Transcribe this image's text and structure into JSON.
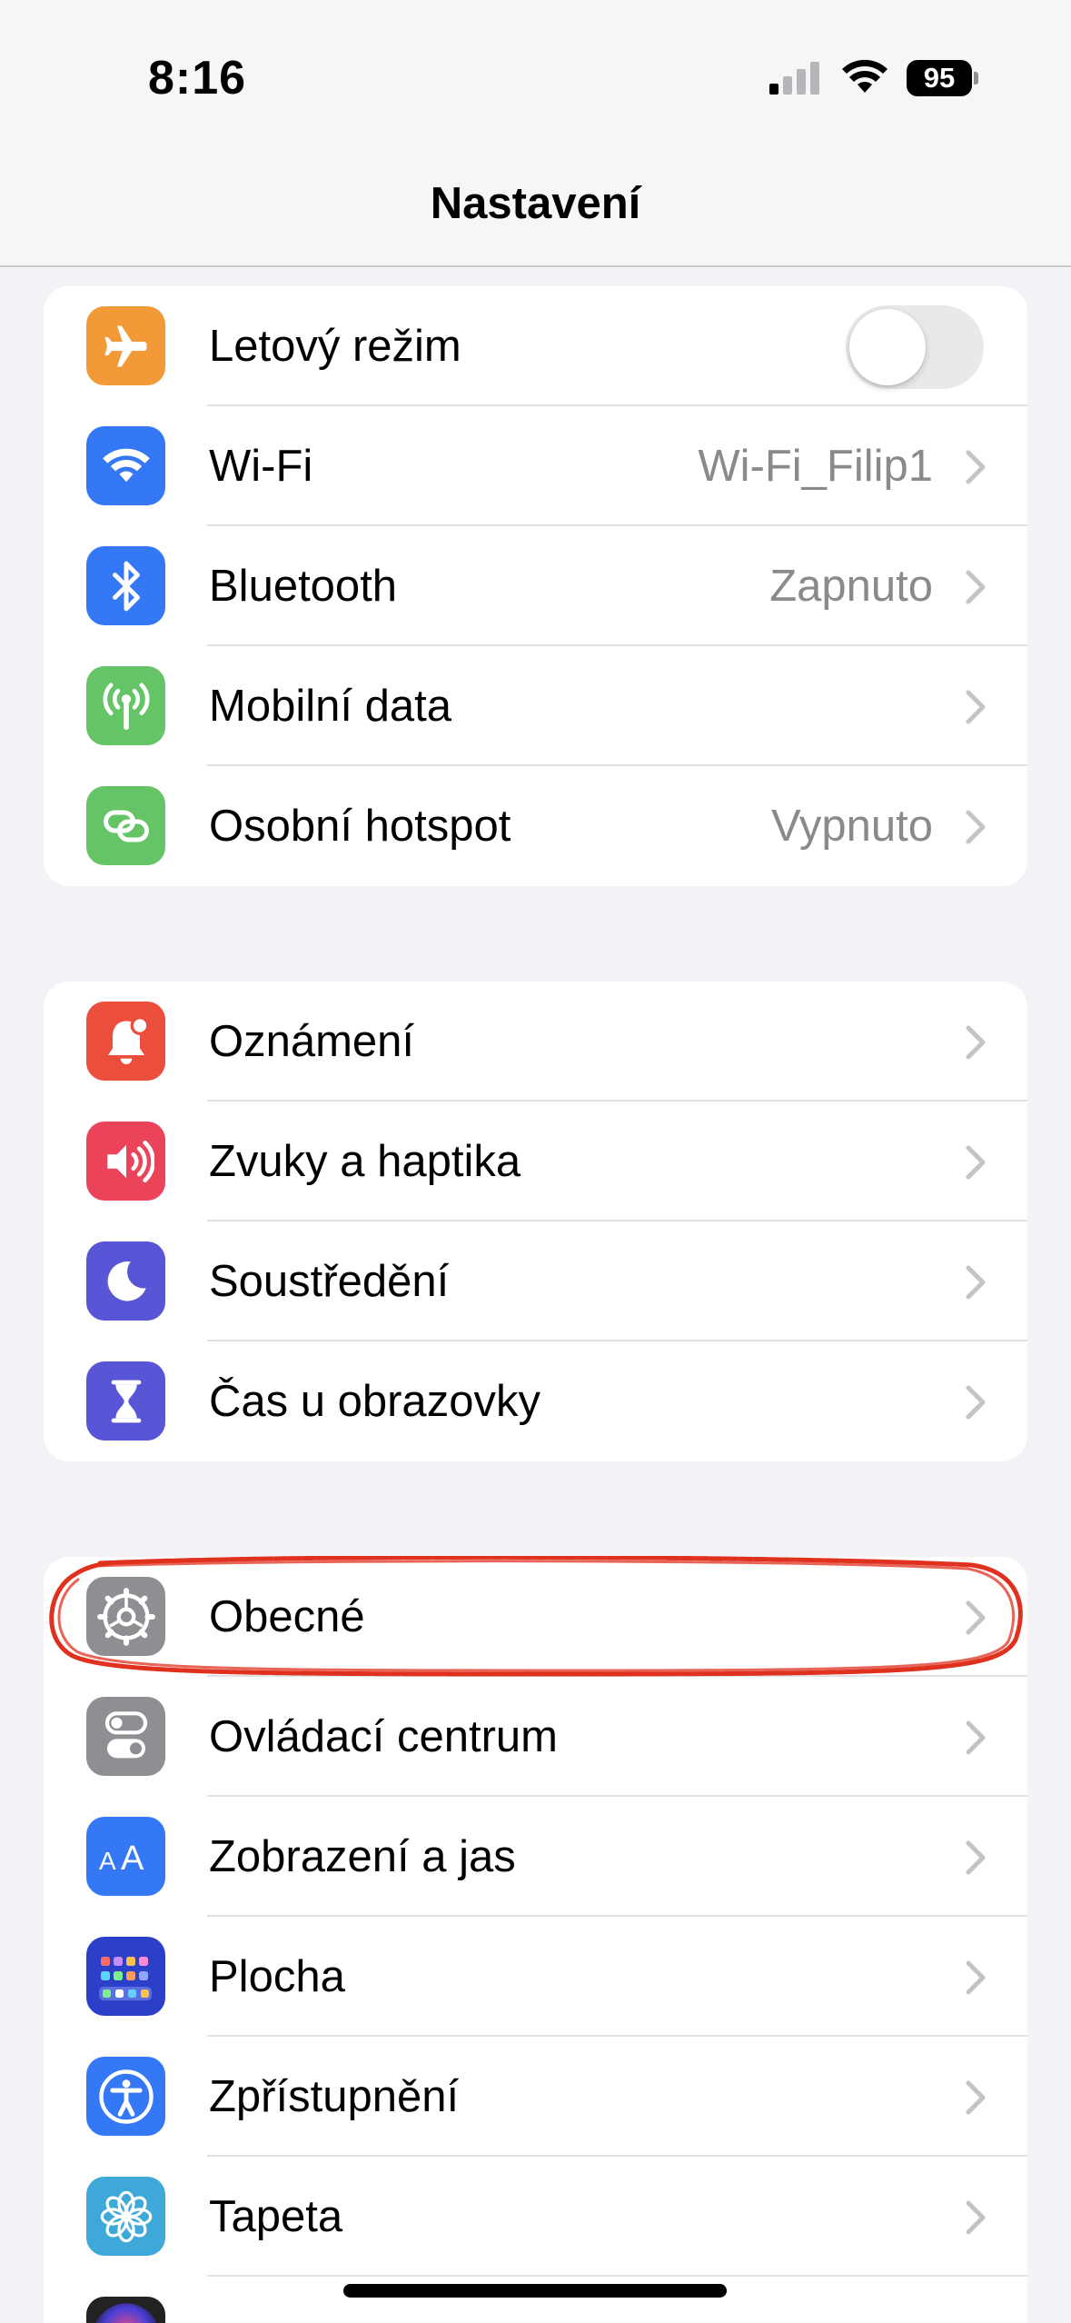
{
  "status_bar": {
    "time": "8:16",
    "battery": "95",
    "icons": [
      "cellular-signal-icon",
      "wifi-icon",
      "battery-icon"
    ]
  },
  "header": {
    "title": "Nastavení"
  },
  "groups": [
    {
      "rows": [
        {
          "label": "Letový režim",
          "icon": "airplane-icon",
          "color": "#f19a37",
          "control": "toggle",
          "toggle_on": false
        },
        {
          "label": "Wi-Fi",
          "value": "Wi-Fi_Filip1",
          "icon": "wifi-icon",
          "color": "#3478f6"
        },
        {
          "label": "Bluetooth",
          "value": "Zapnuto",
          "icon": "bluetooth-icon",
          "color": "#3478f6"
        },
        {
          "label": "Mobilní data",
          "value": "",
          "icon": "antenna-icon",
          "color": "#65c466"
        },
        {
          "label": "Osobní hotspot",
          "value": "Vypnuto",
          "icon": "hotspot-link-icon",
          "color": "#65c466"
        }
      ]
    },
    {
      "rows": [
        {
          "label": "Oznámení",
          "icon": "notification-bell-icon",
          "color": "#eb4e3d"
        },
        {
          "label": "Zvuky a haptika",
          "icon": "speaker-icon",
          "color": "#eb445a"
        },
        {
          "label": "Soustředění",
          "icon": "moon-icon",
          "color": "#5856d6"
        },
        {
          "label": "Čas u obrazovky",
          "icon": "hourglass-icon",
          "color": "#5856d6"
        }
      ]
    },
    {
      "rows": [
        {
          "label": "Obecné",
          "icon": "gear-icon",
          "color": "#8e8e93"
        },
        {
          "label": "Ovládací centrum",
          "icon": "toggles-icon",
          "color": "#8e8e93"
        },
        {
          "label": "Zobrazení a jas",
          "icon": "text-size-icon",
          "color": "#3478f6"
        },
        {
          "label": "Plocha",
          "icon": "home-screen-grid-icon",
          "color": "#2c3fc9"
        },
        {
          "label": "Zpřístupnění",
          "icon": "accessibility-icon",
          "color": "#3478f6"
        },
        {
          "label": "Tapeta",
          "icon": "flower-icon",
          "color": "#3ea9d8"
        },
        {
          "label": "",
          "icon": "siri-icon",
          "color": "#222222"
        }
      ]
    }
  ],
  "annotation": {
    "highlighted_row": "Obecné",
    "color": "#e0301e"
  }
}
